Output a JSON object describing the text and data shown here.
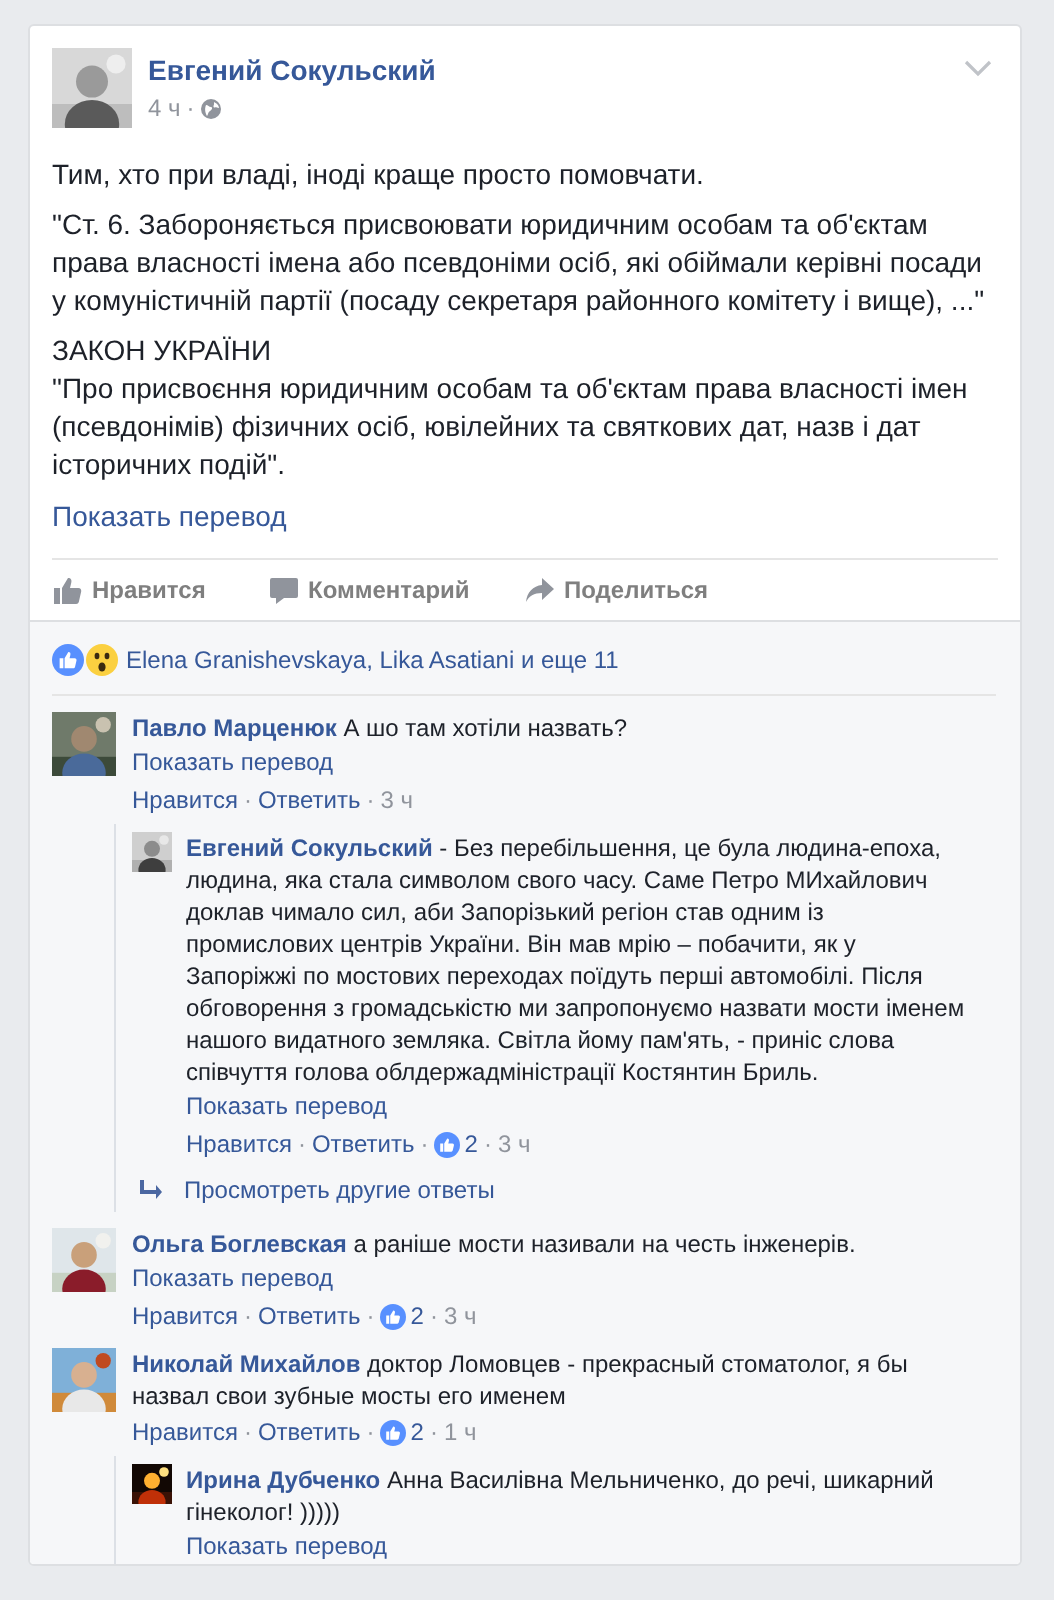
{
  "post": {
    "author": "Евгений Сокульский",
    "time": "4 ч",
    "separator": "·",
    "paragraphs": [
      "Тим, хто при владі, іноді краще просто помовчати.",
      "\"Ст. 6. Забороняється присвоювати юридичним особам та об'єктам права власності імена або псевдоніми осіб, які обіймали керівні посади у комуністичній партії (посаду секретаря районного комітету і вище), ...\"",
      "ЗАКОН УКРАЇНИ\n\"Про присвоєння юридичним особам та об'єктам права власності імен (псевдонімів) фізичних осіб, ювілейних та святкових дат, назв і дат історичних подій\"."
    ],
    "translate": "Показать перевод"
  },
  "actions": [
    {
      "kind": "like",
      "label": "Нравится"
    },
    {
      "kind": "comment",
      "label": "Комментарий"
    },
    {
      "kind": "share",
      "label": "Поделиться"
    }
  ],
  "reactions": {
    "icons": [
      {
        "kind": "like"
      },
      {
        "kind": "wow"
      }
    ],
    "text": "Elena Granishevskaya, Lika Asatiani и еще 11"
  },
  "separator": "·",
  "comments": [
    {
      "author": "Павло Марценюк",
      "text": "А шо там хотіли назвать?",
      "translate": "Показать перевод",
      "like": "Нравится",
      "reply": "Ответить",
      "time": "3 ч",
      "replies": [
        {
          "author": "Евгений Сокульский",
          "text": "- Без перебільшення, це була людина-епоха, людина, яка стала символом свого часу. Саме Петро МИхайлович доклав чимало сил, аби Запорізький регіон став одним із промислових центрів України. Він мав мрію – побачити, як у Запоріжжі по мостових переходах поїдуть перші автомобілі. Після обговорення з громадськістю ми запропонуємо назвати мости іменем нашого видатного земляка. Світла йому пам'ять, - приніс слова співчуття голова облдержадміністрації Костянтин Бриль.",
          "translate": "Показать перевод",
          "like": "Нравится",
          "reply": "Ответить",
          "likes": "2",
          "time": "3 ч"
        }
      ],
      "more_replies": "Просмотреть другие ответы"
    },
    {
      "author": "Ольга Боглевская",
      "text": "а раніше мости називали на честь інженерів.",
      "translate": "Показать перевод",
      "like": "Нравится",
      "reply": "Ответить",
      "likes": "2",
      "time": "3 ч"
    },
    {
      "author": "Николай Михайлов",
      "text": "доктор Ломовцев - прекрасный стоматолог, я бы назвал свои зубные мосты его именем",
      "like": "Нравится",
      "reply": "Ответить",
      "likes": "2",
      "time": "1 ч",
      "replies": [
        {
          "author": "Ирина Дубченко",
          "text": "Анна Василівна Мельниченко, до речі, шикарний гінеколог! )))))",
          "translate": "Показать перевод"
        }
      ]
    }
  ]
}
